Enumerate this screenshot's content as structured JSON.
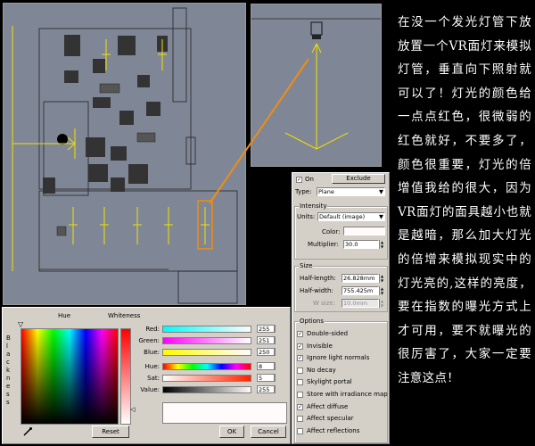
{
  "color_selector": {
    "hue_label": "Hue",
    "whiteness_label": "Whiteness",
    "blackness_label": "Blackness",
    "channels": [
      {
        "label": "Red:",
        "value": "255"
      },
      {
        "label": "Green:",
        "value": "251"
      },
      {
        "label": "Blue:",
        "value": "250"
      },
      {
        "label": "Hue:",
        "value": "8"
      },
      {
        "label": "Sat:",
        "value": "5"
      },
      {
        "label": "Value:",
        "value": "255"
      }
    ],
    "reset_label": "Reset",
    "ok_label": "OK",
    "cancel_label": "Cancel",
    "swatch_color": "#fffbfa"
  },
  "light_panel": {
    "on_label": "On",
    "on_checked": true,
    "exclude_label": "Exclude",
    "type_label": "Type:",
    "type_value": "Plane",
    "intensity_title": "Intensity",
    "units_label": "Units:",
    "units_value": "Default (image)",
    "color_label": "Color:",
    "multiplier_label": "Multiplier:",
    "multiplier_value": "30.0",
    "size_title": "Size",
    "half_length_label": "Half-length:",
    "half_length_value": "26.828mm",
    "half_width_label": "Half-width:",
    "half_width_value": "755.425m",
    "w_size_label": "W size:",
    "w_size_value": "10.0mm",
    "options_title": "Options",
    "options": [
      {
        "label": "Double-sided",
        "checked": true
      },
      {
        "label": "Invisible",
        "checked": true
      },
      {
        "label": "Ignore light normals",
        "checked": true
      },
      {
        "label": "No decay",
        "checked": false
      },
      {
        "label": "Skylight portal",
        "checked": false
      },
      {
        "label": "Store with irradiance map",
        "checked": false
      },
      {
        "label": "Affect diffuse",
        "checked": true
      },
      {
        "label": "Affect specular",
        "checked": false
      },
      {
        "label": "Affect reflections",
        "checked": false
      }
    ]
  },
  "annotation_text": "在没一个发光灯管下放放置一个VR面灯来模拟灯管，垂直向下照射就可以了！灯光的颜色给一点点红色，很微弱的红色就好，不要多了，颜色很重要，灯光的倍增值我给的很大，因为VR面灯的面具越小也就是越暗，那么加大灯光的倍增来模拟现实中的灯光亮的,这样的亮度，要在指数的曝光方式上才可用，要不就曝光的很厉害了，大家一定要注意这点！",
  "colors": {
    "viewport_bg": "#7f8796",
    "light_yellow": "#f0e000",
    "highlight_orange": "#f08c14",
    "panel_gray": "#d4d0c8"
  }
}
